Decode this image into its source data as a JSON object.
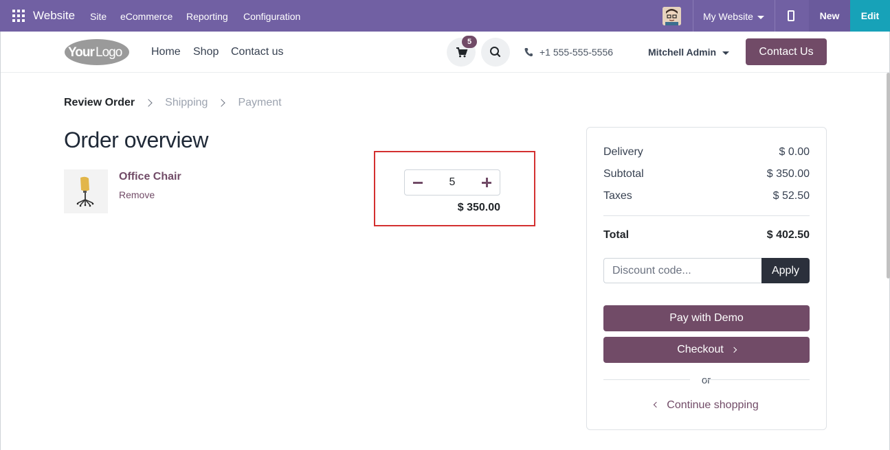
{
  "admin_bar": {
    "app_name": "Website",
    "menu": [
      "Site",
      "eCommerce",
      "Reporting",
      "Configuration"
    ],
    "website_selector": "My Website",
    "new_label": "New",
    "edit_label": "Edit"
  },
  "header": {
    "logo_text": "YourLogo",
    "nav": [
      "Home",
      "Shop",
      "Contact us"
    ],
    "cart_count": "5",
    "phone": "+1 555-555-5556",
    "user_name": "Mitchell Admin",
    "contact_button": "Contact Us"
  },
  "breadcrumb": {
    "steps": [
      "Review Order",
      "Shipping",
      "Payment"
    ]
  },
  "order": {
    "title": "Order overview",
    "items": [
      {
        "name": "Office Chair",
        "remove_label": "Remove",
        "quantity": "5",
        "price": "$ 350.00"
      }
    ]
  },
  "summary": {
    "delivery_label": "Delivery",
    "delivery_value": "$ 0.00",
    "subtotal_label": "Subtotal",
    "subtotal_value": "$ 350.00",
    "taxes_label": "Taxes",
    "taxes_value": "$ 52.50",
    "total_label": "Total",
    "total_value": "$ 402.50",
    "discount_placeholder": "Discount code...",
    "apply_label": "Apply",
    "pay_label": "Pay with Demo",
    "checkout_label": "Checkout",
    "or_label": "or",
    "continue_label": "Continue shopping"
  },
  "colors": {
    "admin_bar": "#7160a3",
    "brand": "#714b67",
    "edit": "#17a2b8",
    "highlight": "#d32f2f"
  }
}
